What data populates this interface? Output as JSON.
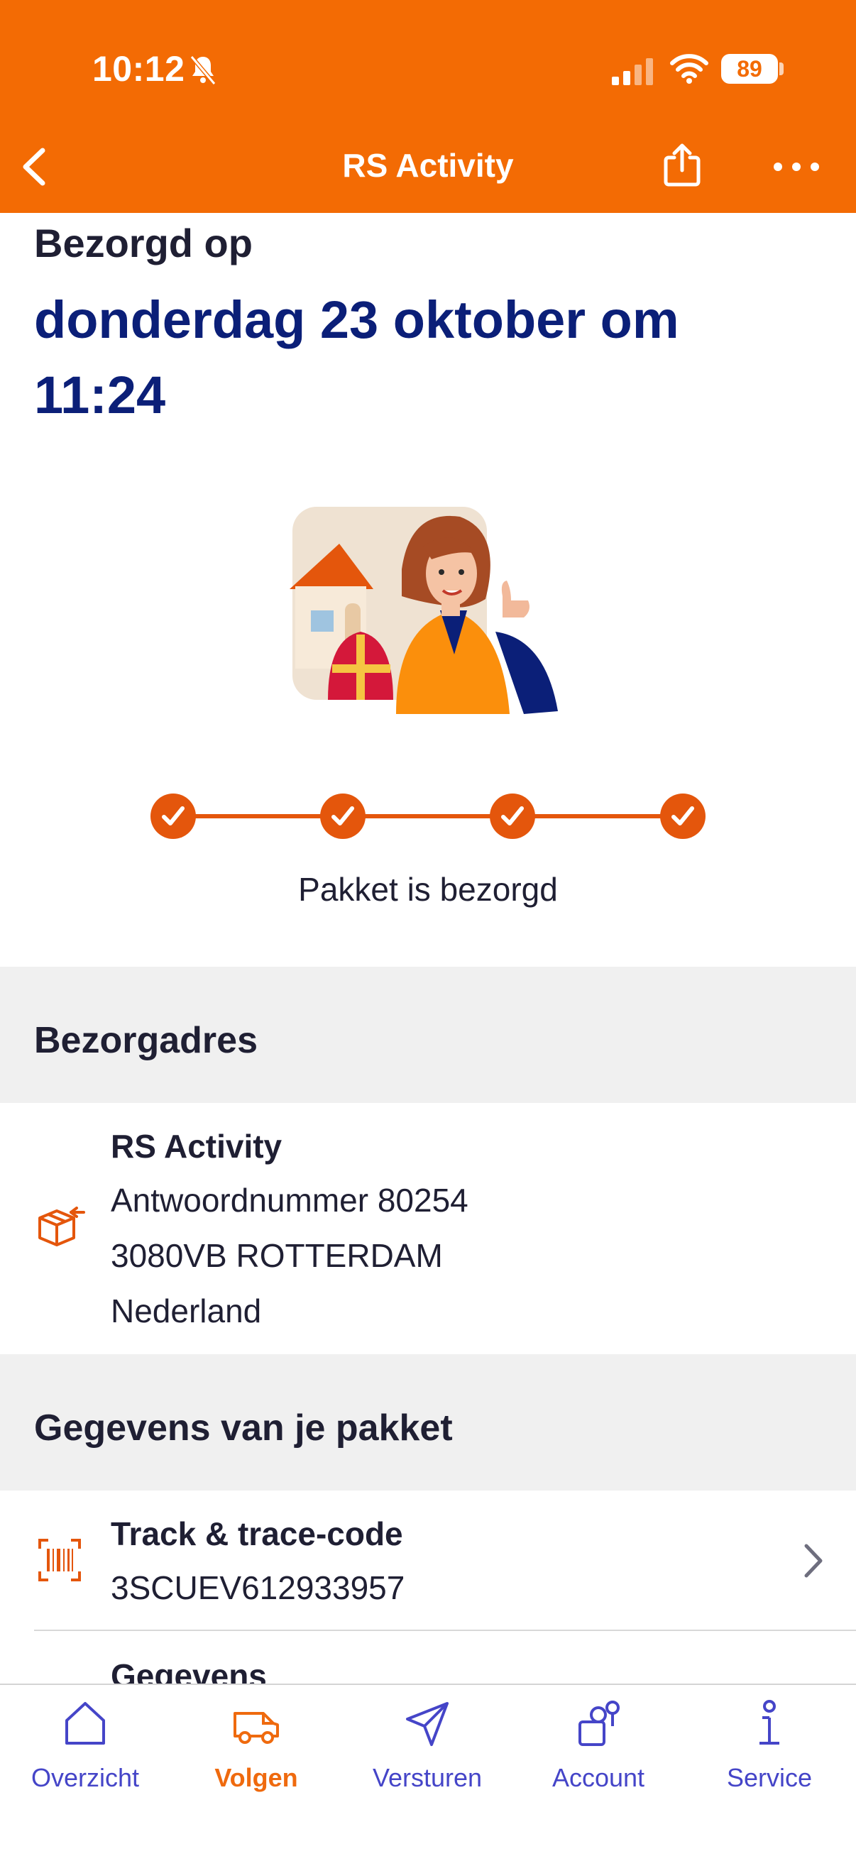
{
  "status_bar": {
    "time": "10:12",
    "battery": "89"
  },
  "nav": {
    "title": "RS Activity"
  },
  "delivery": {
    "label": "Bezorgd op",
    "date_line1": "donderdag 23 oktober om",
    "date_line2": "11:24",
    "status": "Pakket is bezorgd",
    "progress_steps_completed": 4,
    "progress_steps_total": 4
  },
  "address_section": {
    "title": "Bezorgadres",
    "name": "RS Activity",
    "lines": [
      "Antwoordnummer 80254",
      "3080VB ROTTERDAM",
      "Nederland"
    ]
  },
  "package_section": {
    "title": "Gegevens van je pakket",
    "track_title": "Track & trace-code",
    "track_code": "3SCUEV612933957",
    "next_item": "Gegevens"
  },
  "tabs": [
    {
      "label": "Overzicht",
      "icon": "home-icon",
      "active": false
    },
    {
      "label": "Volgen",
      "icon": "truck-icon",
      "active": true
    },
    {
      "label": "Versturen",
      "icon": "send-icon",
      "active": false
    },
    {
      "label": "Account",
      "icon": "account-icon",
      "active": false
    },
    {
      "label": "Service",
      "icon": "info-icon",
      "active": false
    }
  ],
  "colors": {
    "brand_orange": "#f36b04",
    "navy": "#0b1f78",
    "accent_orange": "#e4560c",
    "tab_blue": "#4545c8"
  }
}
